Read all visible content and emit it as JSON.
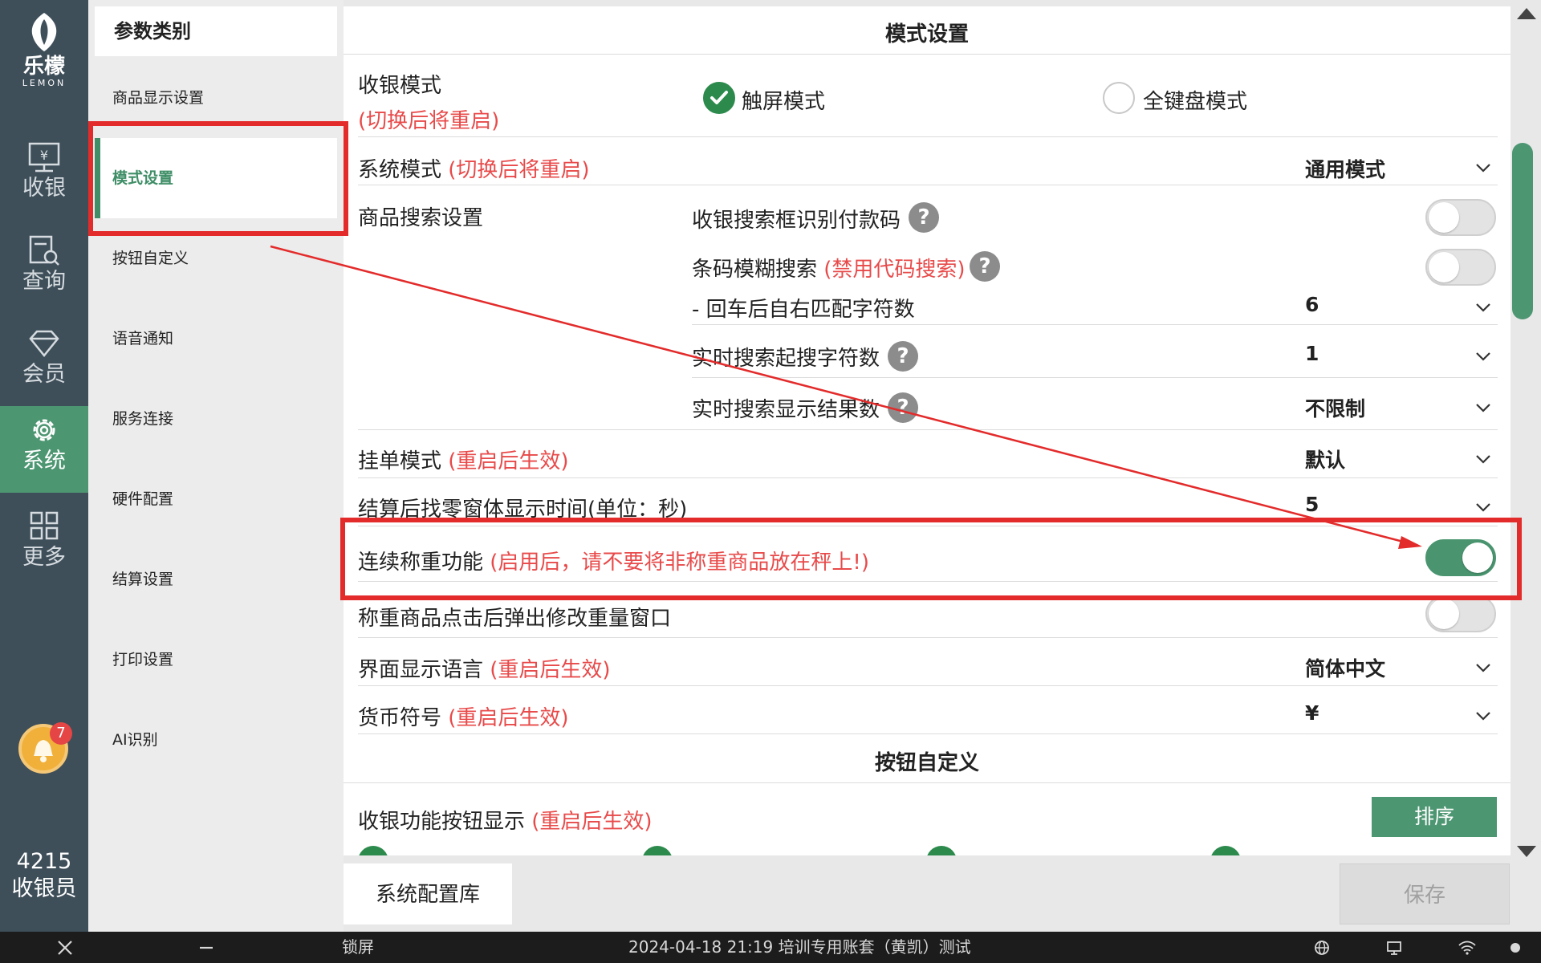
{
  "nav": {
    "logo_cn": "乐檬",
    "logo_en": "LEMON",
    "items": [
      {
        "label": "收银",
        "icon": "cashier-icon"
      },
      {
        "label": "查询",
        "icon": "query-icon"
      },
      {
        "label": "会员",
        "icon": "member-diamond-icon"
      },
      {
        "label": "系统",
        "icon": "gear-icon"
      },
      {
        "label": "更多",
        "icon": "grid-icon"
      }
    ],
    "active": "系统",
    "notification_count": "7",
    "user_id": "4215",
    "user_role": "收银员"
  },
  "categories": {
    "header": "参数类别",
    "items": [
      "商品显示设置",
      "模式设置",
      "按钮自定义",
      "语音通知",
      "服务连接",
      "硬件配置",
      "结算设置",
      "打印设置",
      "AI识别"
    ],
    "active": "模式设置"
  },
  "main": {
    "section_mode_title": "模式设置",
    "cash_mode_label": "收银模式",
    "cash_mode_note": "(切换后将重启)",
    "cash_mode_options": [
      {
        "label": "触屏模式",
        "checked": true
      },
      {
        "label": "全键盘模式",
        "checked": false
      }
    ],
    "system_mode_label": "系统模式",
    "system_mode_note": "(切换后将重启)",
    "system_mode_value": "通用模式",
    "product_search_label": "商品搜索设置",
    "search_recognize_label": "收银搜索框识别付款码",
    "search_recognize_on": false,
    "barcode_fuzzy_label": "条码模糊搜索",
    "barcode_fuzzy_note": "(禁用代码搜索)",
    "barcode_fuzzy_on": false,
    "enter_match_label": "- 回车后自右匹配字符数",
    "enter_match_value": "6",
    "realtime_start_label": "实时搜索起搜字符数",
    "realtime_start_value": "1",
    "realtime_results_label": "实时搜索显示结果数",
    "realtime_results_value": "不限制",
    "hold_mode_label": "挂单模式",
    "hold_mode_note": "(重启后生效)",
    "hold_mode_value": "默认",
    "change_window_label": "结算后找零窗体显示时间(单位：秒)",
    "change_window_value": "5",
    "continuous_weigh_label": "连续称重功能",
    "continuous_weigh_note": "(启用后，请不要将非称重商品放在秤上!)",
    "continuous_weigh_on": true,
    "weigh_popup_label": "称重商品点击后弹出修改重量窗口",
    "weigh_popup_on": false,
    "ui_language_label": "界面显示语言",
    "ui_language_note": "(重启后生效)",
    "ui_language_value": "简体中文",
    "currency_label": "货币符号",
    "currency_note": "(重启后生效)",
    "currency_value": "¥",
    "section_buttons_title": "按钮自定义",
    "func_buttons_label": "收银功能按钮显示",
    "func_buttons_note": "(重启后生效)",
    "sort_button": "排序"
  },
  "footer": {
    "config_lib_button": "系统配置库",
    "save_button": "保存"
  },
  "taskbar": {
    "lock_label": "锁屏",
    "status_text": "2024-04-18 21:19 培训专用账套（黄凯）测试"
  },
  "colors": {
    "nav_bg": "#3f4f5a",
    "accent_green": "#4d9672",
    "note_red": "#e84a4a",
    "annotation_red": "#e32b2b"
  }
}
